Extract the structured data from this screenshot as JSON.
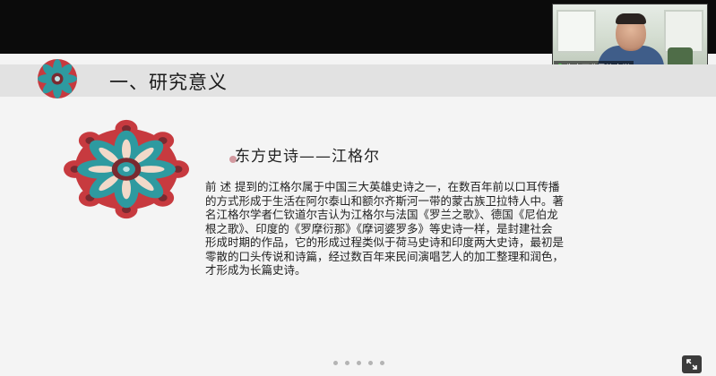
{
  "participant": {
    "name": "朱杰西北民族大学"
  },
  "slide": {
    "title": "一、研究意义",
    "heading": "东方史诗——江格尔",
    "body_lines": [
      "前 述 提到的江格尔属于中国三大英雄史诗之一，在数百年前以口耳传播",
      "的方式形成于生活在阿尔泰山和额尔齐斯河一带的蒙古族卫拉特人中。著",
      "名江格尔学者仁钦道尔吉认为江格尔与法国《罗兰之歌》、德国《尼伯龙",
      "根之歌》、印度的《罗摩衍那》《摩诃婆罗多》等史诗一样，是封建社会",
      "形成时期的作品，它的形成过程类似于荷马史诗和印度两大史诗，最初是",
      "零散的口头传说和诗篇，经过数百年来民间演唱艺人的加工整理和润色，",
      "才形成为长篇史诗。"
    ]
  },
  "colors": {
    "mandala_primary": "#c73a3f",
    "mandala_accent": "#2e9aa0",
    "mandala_dark": "#7a2a30"
  },
  "icons": {
    "mic": "microphone-icon",
    "expand": "expand-icon",
    "mandala": "mandala-ornament"
  }
}
